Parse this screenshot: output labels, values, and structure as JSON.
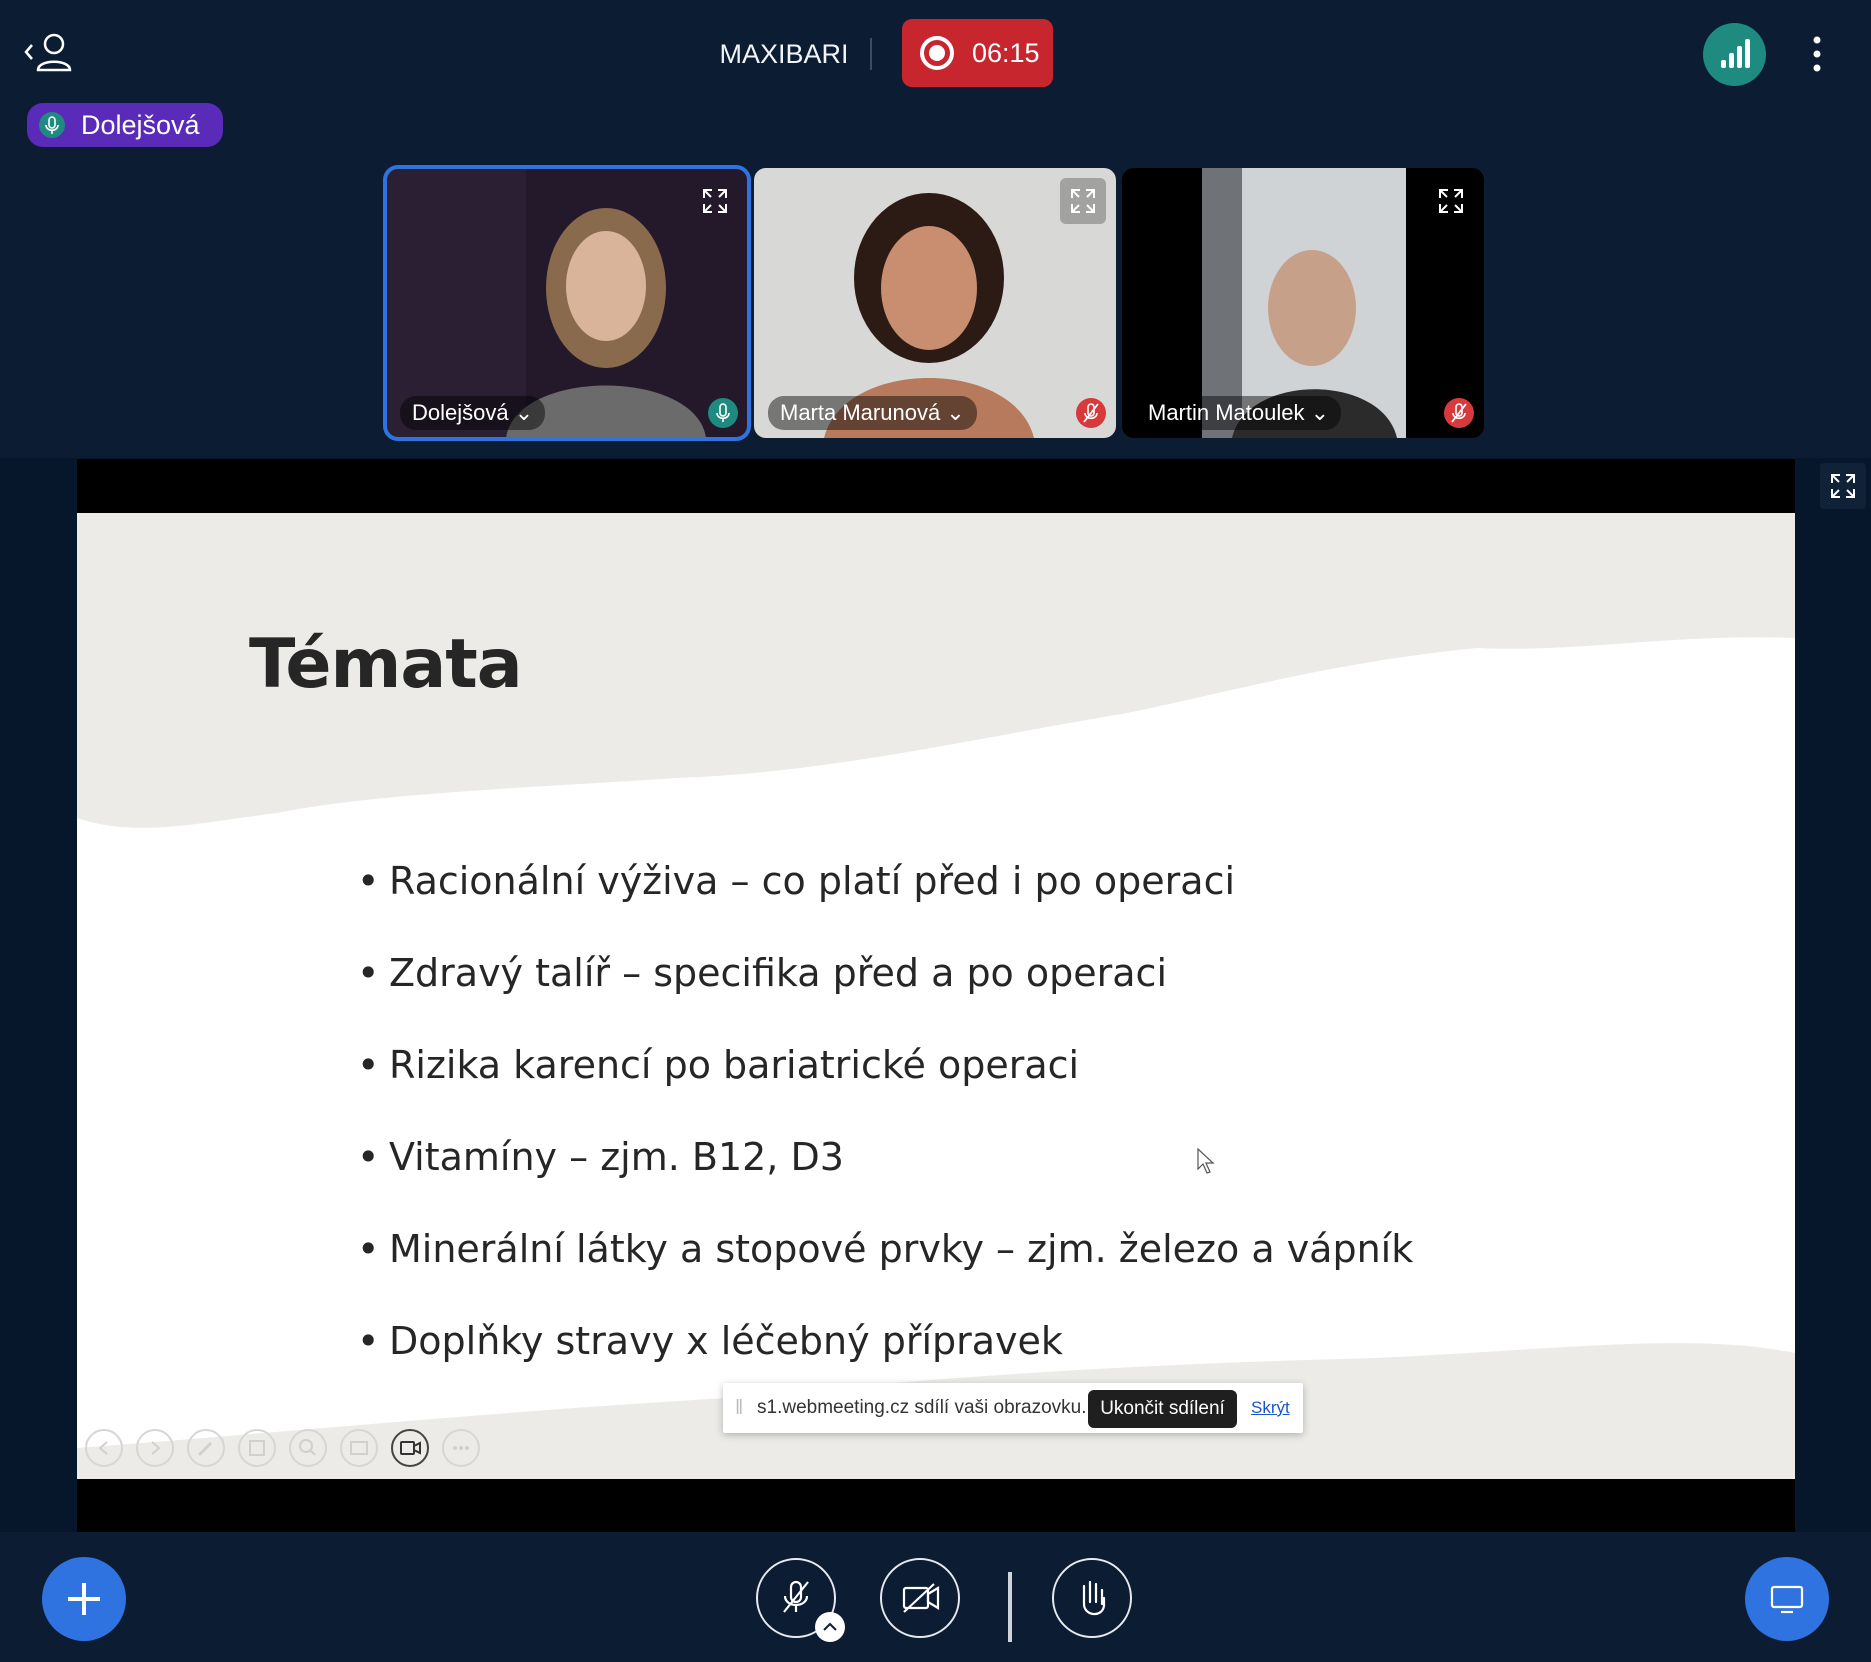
{
  "header": {
    "room_name": "MAXIBARI",
    "recording_time": "06:15",
    "active_speaker": "Dolejšová"
  },
  "participants": [
    {
      "name": "Dolejšová",
      "mic": "on"
    },
    {
      "name": "Marta Marunová",
      "mic": "muted"
    },
    {
      "name": "Martin Matoulek",
      "mic": "muted"
    }
  ],
  "slide": {
    "title": "Témata",
    "bullets": [
      "Racionální výživa – co platí před i po operaci",
      "Zdravý talíř – specifika před a po operaci",
      "Rizika karencí po bariatrické operaci",
      "Vitamíny – zjm. B12, D3",
      "Minerální látky a stopové prvky – zjm. železo a vápník",
      "Doplňky stravy x léčebný přípravek"
    ]
  },
  "share_banner": {
    "message": "s1.webmeeting.cz sdílí vaši obrazovku.",
    "stop_label": "Ukončit sdílení",
    "hide_label": "Skrýt"
  },
  "colors": {
    "background": "#0b1c33",
    "recording": "#c8262f",
    "accent_blue": "#2f73e0",
    "signal_teal": "#1f8a80",
    "speaker_chip": "#5a2ab8"
  },
  "icons": [
    "back-user-icon",
    "record-icon",
    "signal-icon",
    "kebab-icon",
    "expand-icon",
    "mic-icon",
    "mic-muted-icon",
    "plus-icon",
    "camera-off-icon",
    "raise-hand-icon",
    "share-screen-icon"
  ]
}
